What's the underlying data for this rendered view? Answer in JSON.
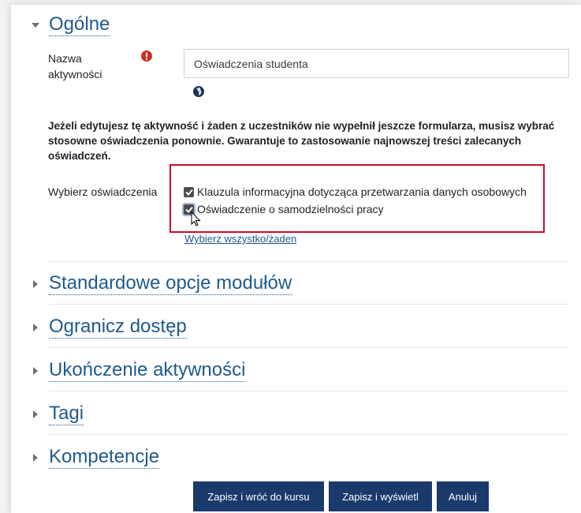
{
  "sections": {
    "general": "Ogólne",
    "standard": "Standardowe opcje modułów",
    "restrict": "Ogranicz dostęp",
    "completion": "Ukończenie aktywności",
    "tags": "Tagi",
    "competencies": "Kompetencje"
  },
  "form": {
    "name_label": "Nazwa aktywności",
    "name_value": "Oświadczenia studenta",
    "notice": "Jeżeli edytujesz tę aktywność i żaden z uczestników nie wypełnił jeszcze formularza, musisz wybrać stosowne oświadczenia ponownie. Gwarantuje to zastosowanie najnowszej treści zalecanych oświadczeń.",
    "choose_label": "Wybierz oświadczenia",
    "options": [
      {
        "label": "Klauzula informacyjna dotycząca przetwarzania danych osobowych",
        "checked": true
      },
      {
        "label": "Oświadczenie o samodzielności pracy",
        "checked": true
      }
    ],
    "select_all": "Wybierz wszystko/żaden"
  },
  "buttons": {
    "save_return": "Zapisz i wróć do kursu",
    "save_display": "Zapisz i wyświetl",
    "cancel": "Anuluj"
  },
  "colors": {
    "link": "#1f5a8d",
    "button": "#1a3a6c",
    "required": "#ca3120",
    "highlight": "#c8102e"
  }
}
